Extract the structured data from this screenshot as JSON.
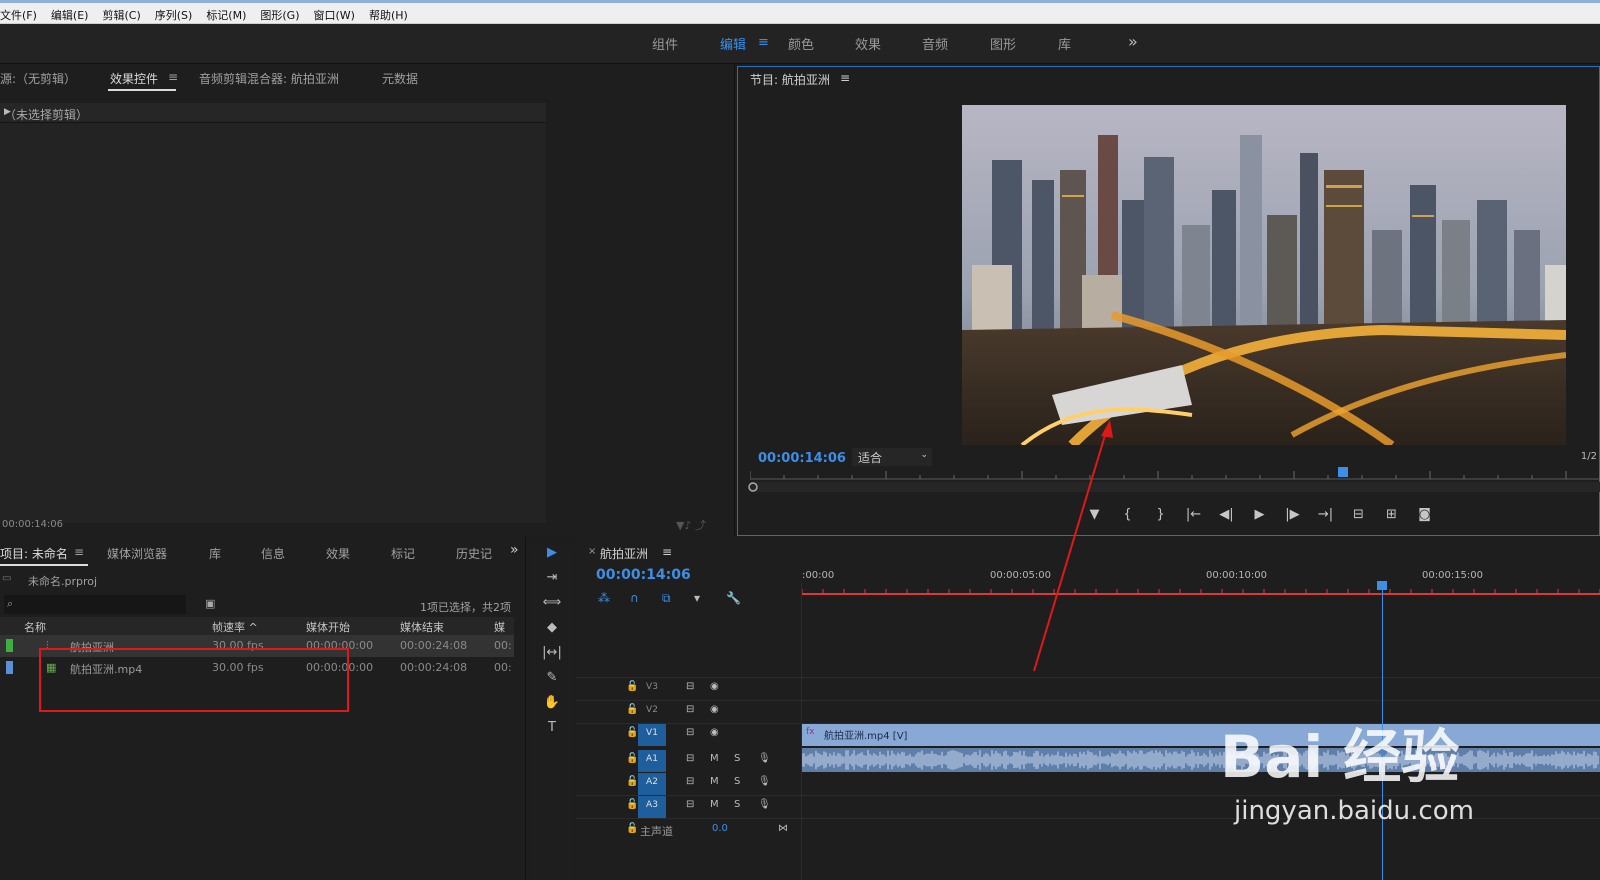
{
  "menu": [
    "文件(F)",
    "编辑(E)",
    "剪辑(C)",
    "序列(S)",
    "标记(M)",
    "图形(G)",
    "窗口(W)",
    "帮助(H)"
  ],
  "workspaces": [
    "组件",
    "编辑",
    "颜色",
    "效果",
    "音频",
    "图形",
    "库"
  ],
  "workspaces_active": "编辑",
  "workspaces_more": "»",
  "source": {
    "tabs": [
      "源:（无剪辑）",
      "效果控件",
      "音频剪辑混合器: 航拍亚洲",
      "元数据"
    ],
    "no_clip": "（未选择剪辑）",
    "timecode": "00:00:14:06"
  },
  "program": {
    "title": "节目: 航拍亚洲",
    "timecode": "00:00:14:06",
    "fit": "适合",
    "fraction": "1/2",
    "controls": [
      "marker-icon",
      "mark-in-icon",
      "mark-out-icon",
      "go-to-in-icon",
      "step-back-icon",
      "play-icon",
      "step-forward-icon",
      "go-to-out-icon",
      "lift-icon",
      "extract-icon",
      "camera-icon"
    ],
    "control_glyphs": [
      "▼",
      "{",
      "}",
      "|←",
      "◀|",
      "▶",
      "|▶",
      "→|",
      "⊟",
      "⊞",
      "◙"
    ]
  },
  "project": {
    "tabs": [
      "项目: 未命名",
      "媒体浏览器",
      "库",
      "信息",
      "效果",
      "标记",
      "历史记"
    ],
    "more": "»",
    "file": "未命名.prproj",
    "selection": "1项已选择，共2项",
    "columns": [
      "名称",
      "帧速率 ^",
      "媒体开始",
      "媒体结束",
      "媒体"
    ],
    "items": [
      {
        "name": "航拍亚洲",
        "fps": "30.00 fps",
        "start": "00:00:00:00",
        "end": "00:00:24:08",
        "extra": "00:",
        "color": "#3fae3f"
      },
      {
        "name": "航拍亚洲.mp4",
        "fps": "30.00 fps",
        "start": "00:00:00:00",
        "end": "00:00:24:08",
        "extra": "00:",
        "color": "#5b8fd6"
      }
    ]
  },
  "tools": [
    "selection-tool-icon",
    "track-select-icon",
    "ripple-edit-icon",
    "razor-icon",
    "slip-icon",
    "pen-icon",
    "hand-icon",
    "type-icon"
  ],
  "tool_glyphs": [
    "▶",
    "⇥",
    "⟺",
    "◆",
    "|↔|",
    "✎",
    "✋",
    "T"
  ],
  "timeline": {
    "title": "航拍亚洲",
    "close": "×",
    "timecode": "00:00:14:06",
    "ruler": [
      ":00:00",
      "00:00:05:00",
      "00:00:10:00",
      "00:00:15:00"
    ],
    "video_tracks": [
      "V3",
      "V2",
      "V1"
    ],
    "audio_tracks": [
      "A1",
      "A2",
      "A3"
    ],
    "master": "主声道",
    "master_value": "0.0",
    "clip_label": "航拍亚洲.mp4 [V]",
    "clip_fx": "fx"
  },
  "watermark": {
    "brand": "Bai 经验",
    "url": "jingyan.baidu.com"
  },
  "colors": {
    "accent": "#3d8ee6",
    "annotation": "#e01818"
  }
}
